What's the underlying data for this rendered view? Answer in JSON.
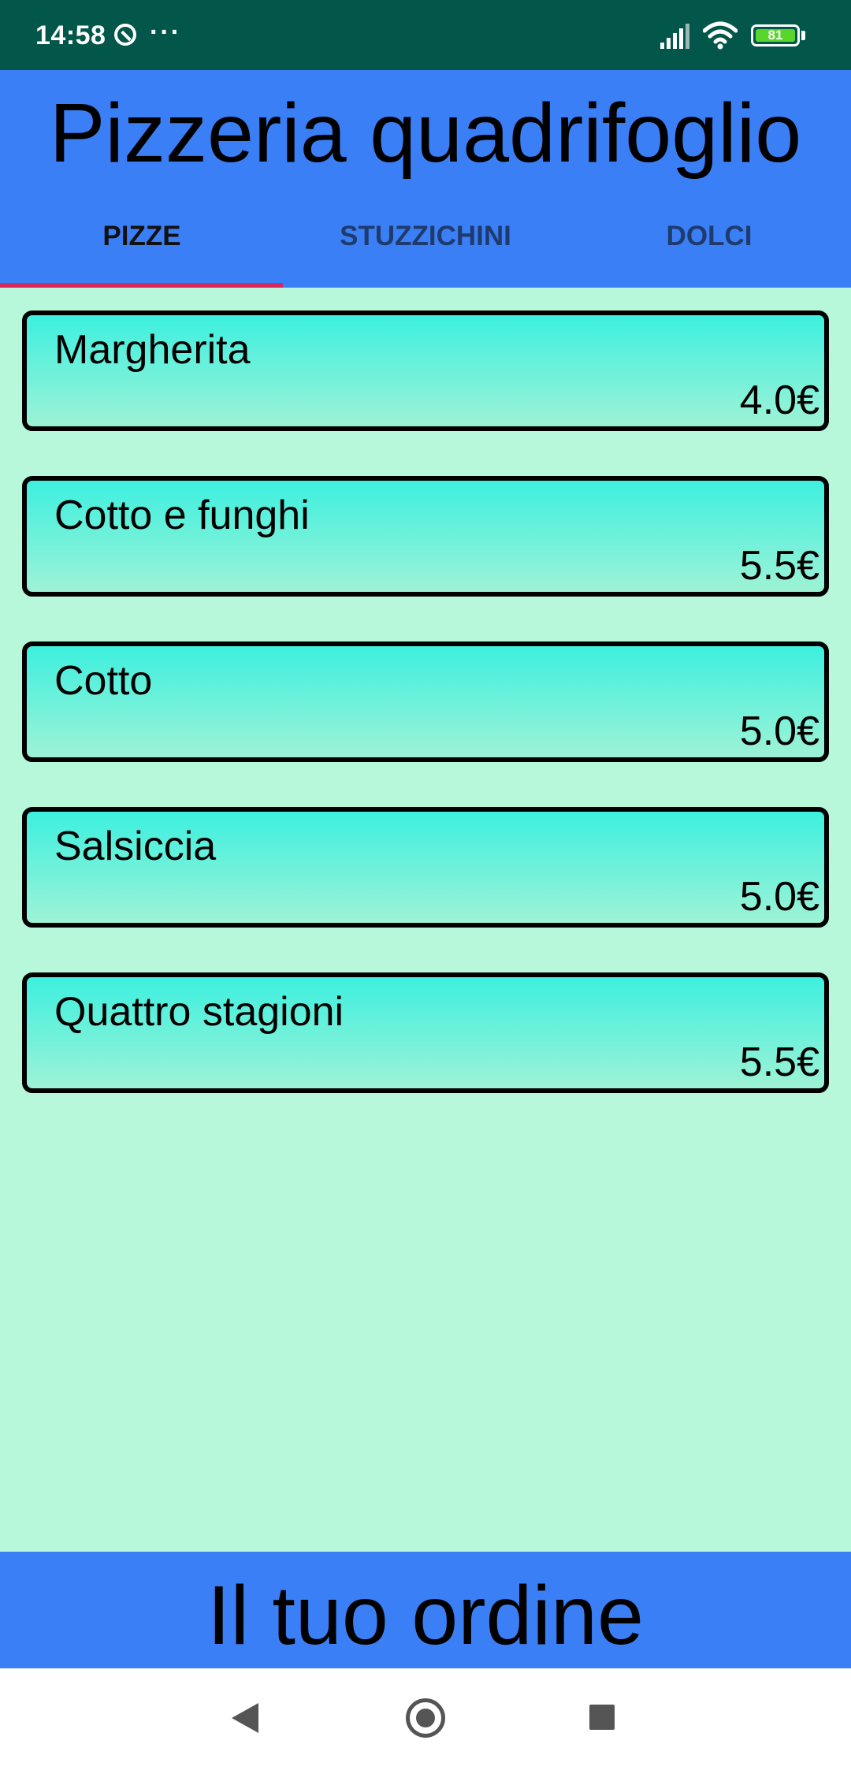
{
  "status_bar": {
    "time": "14:58",
    "more_indicator": "···",
    "battery_level": "81"
  },
  "header": {
    "title": "Pizzeria quadrifoglio"
  },
  "tabs": [
    {
      "label": "PIZZE",
      "selected": true
    },
    {
      "label": "STUZZICHINI",
      "selected": false
    },
    {
      "label": "DOLCI",
      "selected": false
    }
  ],
  "menu_items": [
    {
      "name": "Margherita",
      "price": "4.0€"
    },
    {
      "name": "Cotto e funghi",
      "price": "5.5€"
    },
    {
      "name": "Cotto",
      "price": "5.0€"
    },
    {
      "name": "Salsiccia",
      "price": "5.0€"
    },
    {
      "name": "Quattro stagioni",
      "price": "5.5€"
    }
  ],
  "order_button": {
    "label": "Il tuo ordine"
  },
  "navigation": {
    "back_icon": "back-triangle-icon",
    "home_icon": "home-circle-icon",
    "recents_icon": "recents-square-icon"
  },
  "colors": {
    "status_bar": "#02574a",
    "header": "#3b7ff6",
    "background": "#b7f7da",
    "card_top": "#3df0df",
    "card_bottom": "#9ef2d6",
    "tab_indicator": "#d6285f"
  }
}
